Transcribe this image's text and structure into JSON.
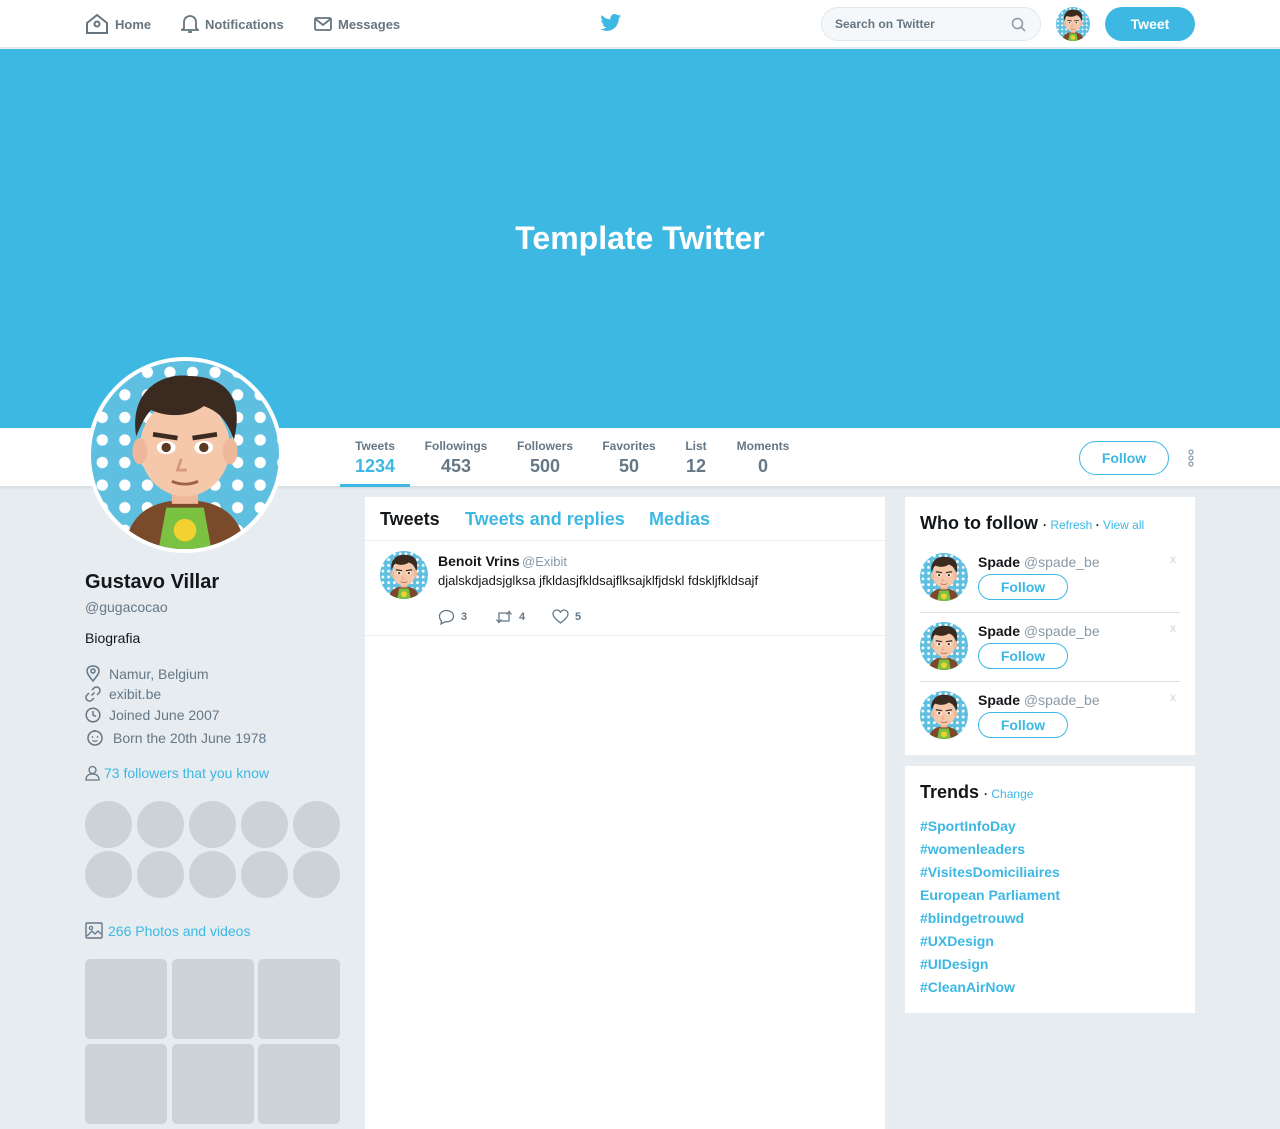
{
  "nav": {
    "home": "Home",
    "notifications": "Notifications",
    "messages": "Messages",
    "search_placeholder": "Search on Twitter",
    "tweet_button": "Tweet"
  },
  "banner": {
    "title": "Template Twitter"
  },
  "stats": [
    {
      "label": "Tweets",
      "value": "1234"
    },
    {
      "label": "Followings",
      "value": "453"
    },
    {
      "label": "Followers",
      "value": "500"
    },
    {
      "label": "Favorites",
      "value": "50"
    },
    {
      "label": "List",
      "value": "12"
    },
    {
      "label": "Moments",
      "value": "0"
    }
  ],
  "profile": {
    "follow_button": "Follow",
    "name": "Gustavo Villar",
    "handle": "@gugacocao",
    "bio": "Biografia",
    "location": "Namur, Belgium",
    "website": "exibit.be",
    "joined": "Joined June 2007",
    "born": "Born the 20th June 1978",
    "followers_you_know": "73 followers that you know",
    "photos_videos": "266 Photos and videos"
  },
  "timeline": {
    "tabs": [
      "Tweets",
      "Tweets and replies",
      "Medias"
    ],
    "tweet": {
      "name": "Benoit Vrins",
      "handle": "@Exibit",
      "text": "djalskdjadsjglksa jfkldasjfkldsajflksajklfjdskl fdskljfkldsajf",
      "replies": "3",
      "retweets": "4",
      "likes": "5"
    }
  },
  "who_to_follow": {
    "title": "Who to follow",
    "separator": "·",
    "refresh": "Refresh",
    "view_all": "View all",
    "users": [
      {
        "name": "Spade",
        "handle": "@spade_be",
        "close": "x",
        "follow": "Follow"
      },
      {
        "name": "Spade",
        "handle": "@spade_be",
        "close": "x",
        "follow": "Follow"
      },
      {
        "name": "Spade",
        "handle": "@spade_be",
        "close": "x",
        "follow": "Follow"
      }
    ]
  },
  "trends": {
    "title": "Trends",
    "separator": "·",
    "change": "Change",
    "items": [
      "#SportInfoDay",
      "#womenleaders",
      "#VisitesDomiciliaires",
      "European Parliament",
      "#blindgetrouwd",
      "#UXDesign",
      "#UIDesign",
      "#CleanAirNow"
    ]
  },
  "colors": {
    "accent": "#3cb8e3",
    "background": "#e6ecf0",
    "placeholder": "#ccd3d8"
  }
}
